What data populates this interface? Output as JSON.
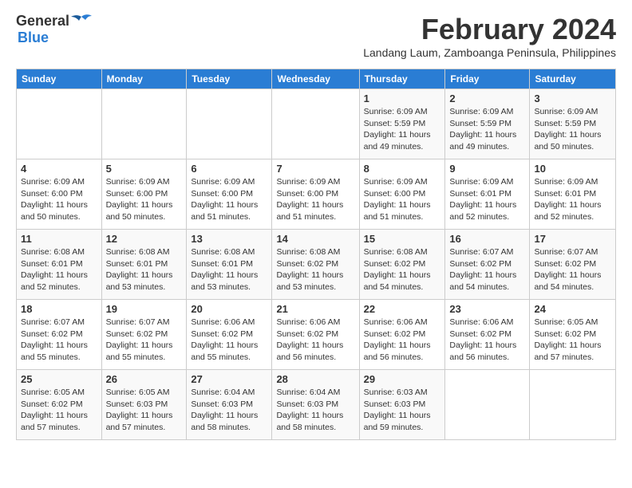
{
  "logo": {
    "general": "General",
    "blue": "Blue"
  },
  "title": "February 2024",
  "location": "Landang Laum, Zamboanga Peninsula, Philippines",
  "days_of_week": [
    "Sunday",
    "Monday",
    "Tuesday",
    "Wednesday",
    "Thursday",
    "Friday",
    "Saturday"
  ],
  "weeks": [
    [
      {
        "day": "",
        "info": ""
      },
      {
        "day": "",
        "info": ""
      },
      {
        "day": "",
        "info": ""
      },
      {
        "day": "",
        "info": ""
      },
      {
        "day": "1",
        "info": "Sunrise: 6:09 AM\nSunset: 5:59 PM\nDaylight: 11 hours\nand 49 minutes."
      },
      {
        "day": "2",
        "info": "Sunrise: 6:09 AM\nSunset: 5:59 PM\nDaylight: 11 hours\nand 49 minutes."
      },
      {
        "day": "3",
        "info": "Sunrise: 6:09 AM\nSunset: 5:59 PM\nDaylight: 11 hours\nand 50 minutes."
      }
    ],
    [
      {
        "day": "4",
        "info": "Sunrise: 6:09 AM\nSunset: 6:00 PM\nDaylight: 11 hours\nand 50 minutes."
      },
      {
        "day": "5",
        "info": "Sunrise: 6:09 AM\nSunset: 6:00 PM\nDaylight: 11 hours\nand 50 minutes."
      },
      {
        "day": "6",
        "info": "Sunrise: 6:09 AM\nSunset: 6:00 PM\nDaylight: 11 hours\nand 51 minutes."
      },
      {
        "day": "7",
        "info": "Sunrise: 6:09 AM\nSunset: 6:00 PM\nDaylight: 11 hours\nand 51 minutes."
      },
      {
        "day": "8",
        "info": "Sunrise: 6:09 AM\nSunset: 6:00 PM\nDaylight: 11 hours\nand 51 minutes."
      },
      {
        "day": "9",
        "info": "Sunrise: 6:09 AM\nSunset: 6:01 PM\nDaylight: 11 hours\nand 52 minutes."
      },
      {
        "day": "10",
        "info": "Sunrise: 6:09 AM\nSunset: 6:01 PM\nDaylight: 11 hours\nand 52 minutes."
      }
    ],
    [
      {
        "day": "11",
        "info": "Sunrise: 6:08 AM\nSunset: 6:01 PM\nDaylight: 11 hours\nand 52 minutes."
      },
      {
        "day": "12",
        "info": "Sunrise: 6:08 AM\nSunset: 6:01 PM\nDaylight: 11 hours\nand 53 minutes."
      },
      {
        "day": "13",
        "info": "Sunrise: 6:08 AM\nSunset: 6:01 PM\nDaylight: 11 hours\nand 53 minutes."
      },
      {
        "day": "14",
        "info": "Sunrise: 6:08 AM\nSunset: 6:02 PM\nDaylight: 11 hours\nand 53 minutes."
      },
      {
        "day": "15",
        "info": "Sunrise: 6:08 AM\nSunset: 6:02 PM\nDaylight: 11 hours\nand 54 minutes."
      },
      {
        "day": "16",
        "info": "Sunrise: 6:07 AM\nSunset: 6:02 PM\nDaylight: 11 hours\nand 54 minutes."
      },
      {
        "day": "17",
        "info": "Sunrise: 6:07 AM\nSunset: 6:02 PM\nDaylight: 11 hours\nand 54 minutes."
      }
    ],
    [
      {
        "day": "18",
        "info": "Sunrise: 6:07 AM\nSunset: 6:02 PM\nDaylight: 11 hours\nand 55 minutes."
      },
      {
        "day": "19",
        "info": "Sunrise: 6:07 AM\nSunset: 6:02 PM\nDaylight: 11 hours\nand 55 minutes."
      },
      {
        "day": "20",
        "info": "Sunrise: 6:06 AM\nSunset: 6:02 PM\nDaylight: 11 hours\nand 55 minutes."
      },
      {
        "day": "21",
        "info": "Sunrise: 6:06 AM\nSunset: 6:02 PM\nDaylight: 11 hours\nand 56 minutes."
      },
      {
        "day": "22",
        "info": "Sunrise: 6:06 AM\nSunset: 6:02 PM\nDaylight: 11 hours\nand 56 minutes."
      },
      {
        "day": "23",
        "info": "Sunrise: 6:06 AM\nSunset: 6:02 PM\nDaylight: 11 hours\nand 56 minutes."
      },
      {
        "day": "24",
        "info": "Sunrise: 6:05 AM\nSunset: 6:02 PM\nDaylight: 11 hours\nand 57 minutes."
      }
    ],
    [
      {
        "day": "25",
        "info": "Sunrise: 6:05 AM\nSunset: 6:02 PM\nDaylight: 11 hours\nand 57 minutes."
      },
      {
        "day": "26",
        "info": "Sunrise: 6:05 AM\nSunset: 6:03 PM\nDaylight: 11 hours\nand 57 minutes."
      },
      {
        "day": "27",
        "info": "Sunrise: 6:04 AM\nSunset: 6:03 PM\nDaylight: 11 hours\nand 58 minutes."
      },
      {
        "day": "28",
        "info": "Sunrise: 6:04 AM\nSunset: 6:03 PM\nDaylight: 11 hours\nand 58 minutes."
      },
      {
        "day": "29",
        "info": "Sunrise: 6:03 AM\nSunset: 6:03 PM\nDaylight: 11 hours\nand 59 minutes."
      },
      {
        "day": "",
        "info": ""
      },
      {
        "day": "",
        "info": ""
      }
    ]
  ]
}
